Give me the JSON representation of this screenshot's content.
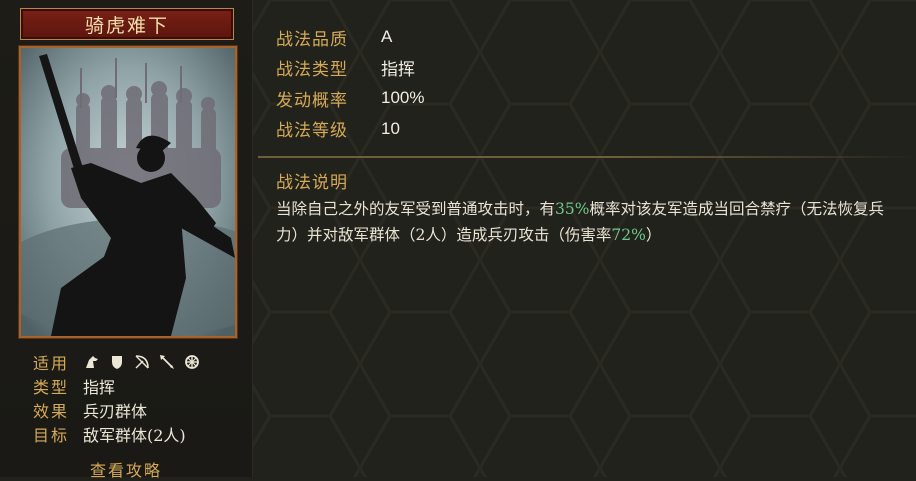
{
  "skill": {
    "name": "骑虎难下"
  },
  "props": {
    "applicable_label": "适用",
    "applicable_icons": [
      "cavalry-icon",
      "shield-icon",
      "bow-icon",
      "spear-icon",
      "chariot-icon"
    ],
    "type_label": "类型",
    "type_value": "指挥",
    "effect_label": "效果",
    "effect_value": "兵刃群体",
    "target_label": "目标",
    "target_value": "敌军群体(2人)"
  },
  "guide_link": "查看攻略",
  "stats": [
    {
      "label": "战法品质",
      "value": "A"
    },
    {
      "label": "战法类型",
      "value": "指挥"
    },
    {
      "label": "发动概率",
      "value": "100%"
    },
    {
      "label": "战法等级",
      "value": "10"
    }
  ],
  "description": {
    "title": "战法说明",
    "parts": [
      "当除自己之外的友军受到普通攻击时，有",
      "35%",
      "概率对该友军造成当回合禁疗（无法恢复兵力）并对敌军群体（2人）造成兵刃攻击（伤害率",
      "72%",
      "）"
    ]
  },
  "colors": {
    "label_gold": "#d5aa57",
    "highlight_green": "#6fc98e",
    "title_red": "#6e1a12"
  }
}
